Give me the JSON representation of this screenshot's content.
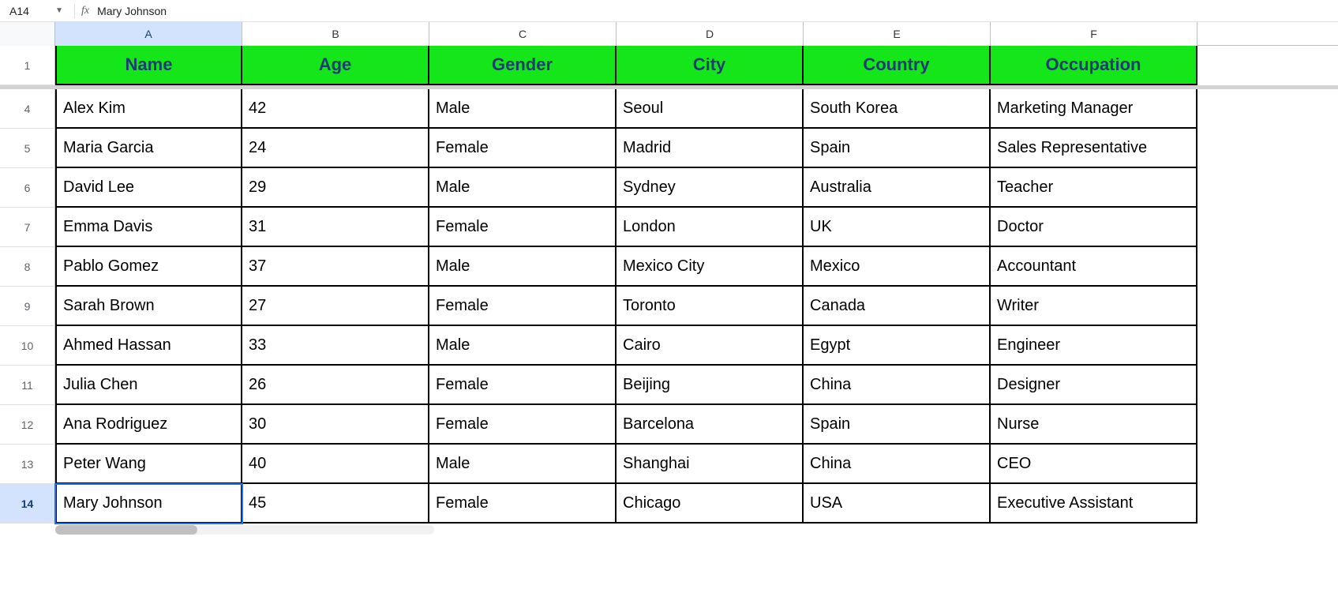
{
  "formula_bar": {
    "cell_ref": "A14",
    "fx_label": "fx",
    "value": "Mary Johnson"
  },
  "columns": [
    "A",
    "B",
    "C",
    "D",
    "E",
    "F"
  ],
  "active_column": 0,
  "header_row_number": "1",
  "headers": [
    "Name",
    "Age",
    "Gender",
    "City",
    "Country",
    "Occupation"
  ],
  "visible_row_numbers": [
    "4",
    "5",
    "6",
    "7",
    "8",
    "9",
    "10",
    "11",
    "12",
    "13",
    "14"
  ],
  "active_row_number": "14",
  "active_cell": {
    "row_idx": 10,
    "col_idx": 0
  },
  "rows": [
    [
      "Alex Kim",
      "42",
      "Male",
      "Seoul",
      "South Korea",
      "Marketing Manager"
    ],
    [
      "Maria Garcia",
      "24",
      "Female",
      "Madrid",
      "Spain",
      "Sales Representative"
    ],
    [
      "David Lee",
      "29",
      "Male",
      "Sydney",
      "Australia",
      "Teacher"
    ],
    [
      "Emma Davis",
      "31",
      "Female",
      "London",
      "UK",
      "Doctor"
    ],
    [
      "Pablo Gomez",
      "37",
      "Male",
      "Mexico City",
      "Mexico",
      "Accountant"
    ],
    [
      "Sarah Brown",
      "27",
      "Female",
      "Toronto",
      "Canada",
      "Writer"
    ],
    [
      "Ahmed Hassan",
      "33",
      "Male",
      "Cairo",
      "Egypt",
      "Engineer"
    ],
    [
      "Julia Chen",
      "26",
      "Female",
      "Beijing",
      "China",
      "Designer"
    ],
    [
      "Ana Rodriguez",
      "30",
      "Female",
      "Barcelona",
      "Spain",
      "Nurse"
    ],
    [
      "Peter Wang",
      "40",
      "Male",
      "Shanghai",
      "China",
      "CEO"
    ],
    [
      "Mary Johnson",
      "45",
      "Female",
      "Chicago",
      "USA",
      "Executive Assistant"
    ]
  ],
  "chart_data": {
    "type": "table",
    "columns": [
      "Name",
      "Age",
      "Gender",
      "City",
      "Country",
      "Occupation"
    ],
    "rows": [
      [
        "Alex Kim",
        42,
        "Male",
        "Seoul",
        "South Korea",
        "Marketing Manager"
      ],
      [
        "Maria Garcia",
        24,
        "Female",
        "Madrid",
        "Spain",
        "Sales Representative"
      ],
      [
        "David Lee",
        29,
        "Male",
        "Sydney",
        "Australia",
        "Teacher"
      ],
      [
        "Emma Davis",
        31,
        "Female",
        "London",
        "UK",
        "Doctor"
      ],
      [
        "Pablo Gomez",
        37,
        "Male",
        "Mexico City",
        "Mexico",
        "Accountant"
      ],
      [
        "Sarah Brown",
        27,
        "Female",
        "Toronto",
        "Canada",
        "Writer"
      ],
      [
        "Ahmed Hassan",
        33,
        "Male",
        "Cairo",
        "Egypt",
        "Engineer"
      ],
      [
        "Julia Chen",
        26,
        "Female",
        "Beijing",
        "China",
        "Designer"
      ],
      [
        "Ana Rodriguez",
        30,
        "Female",
        "Barcelona",
        "Spain",
        "Nurse"
      ],
      [
        "Peter Wang",
        40,
        "Male",
        "Shanghai",
        "China",
        "CEO"
      ],
      [
        "Mary Johnson",
        45,
        "Female",
        "Chicago",
        "USA",
        "Executive Assistant"
      ]
    ]
  }
}
